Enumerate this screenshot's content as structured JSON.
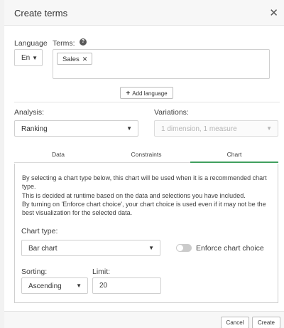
{
  "dialog": {
    "title": "Create terms",
    "close_icon": "close-icon"
  },
  "language": {
    "label": "Language",
    "value": "En"
  },
  "terms": {
    "label": "Terms:",
    "help_icon": "help-icon",
    "chips": [
      {
        "label": "Sales"
      }
    ]
  },
  "add_language": {
    "label": "Add language"
  },
  "analysis": {
    "label": "Analysis:",
    "value": "Ranking"
  },
  "variations": {
    "label": "Variations:",
    "value": "1 dimension, 1 measure"
  },
  "tabs": [
    {
      "label": "Data",
      "active": false
    },
    {
      "label": "Constraints",
      "active": false
    },
    {
      "label": "Chart",
      "active": true
    }
  ],
  "chart_panel": {
    "description_lines": [
      "By selecting a chart type below, this chart will be used when it is a recommended chart type.",
      "This is decided at runtime based on the data and selections you have included.",
      "By turning on 'Enforce chart choice', your chart choice is used even if it may not be the best visualization for the selected data."
    ],
    "chart_type": {
      "label": "Chart type:",
      "value": "Bar chart"
    },
    "enforce_chart_choice": {
      "label": "Enforce chart choice",
      "enabled": false
    },
    "sorting": {
      "label": "Sorting:",
      "value": "Ascending"
    },
    "limit": {
      "label": "Limit:",
      "value": "20"
    }
  },
  "footer": {
    "cancel_label": "Cancel",
    "create_label": "Create"
  },
  "colors": {
    "accent": "#41a05f",
    "header_bg": "#f7f7f7",
    "border": "#cfcfcf"
  }
}
